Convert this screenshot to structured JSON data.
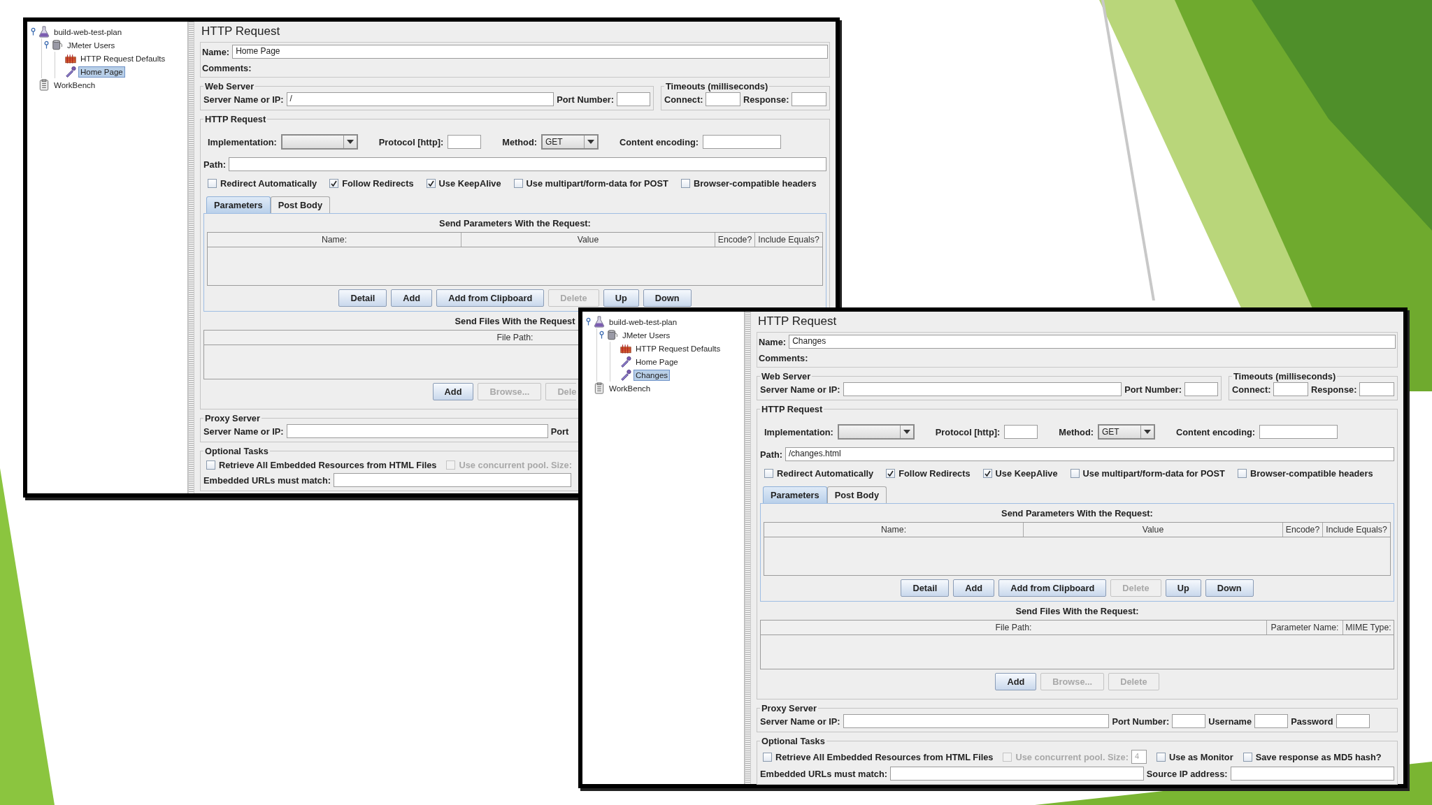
{
  "windows": [
    {
      "tree": [
        {
          "label": "build-web-test-plan",
          "kind": "test-plan",
          "expanded": true,
          "selected": false,
          "children": [
            {
              "label": "JMeter Users",
              "kind": "thread-group",
              "expanded": true,
              "selected": false,
              "children": [
                {
                  "label": "HTTP Request Defaults",
                  "kind": "config",
                  "selected": false
                },
                {
                  "label": "Home Page",
                  "kind": "sampler",
                  "selected": true
                }
              ]
            }
          ]
        },
        {
          "label": "WorkBench",
          "kind": "workbench",
          "selected": false
        }
      ],
      "panel": {
        "title": "HTTP Request",
        "name": {
          "label": "Name:",
          "value": "Home Page"
        },
        "comments": {
          "label": "Comments:"
        },
        "web_server": {
          "legend": "Web Server",
          "fields": [
            {
              "label": "Server Name or IP:",
              "value": "/"
            },
            {
              "label": "Port Number:"
            }
          ]
        },
        "timeouts": {
          "legend": "Timeouts (milliseconds)",
          "fields": [
            {
              "label": "Connect:"
            },
            {
              "label": "Response:"
            }
          ]
        },
        "http_request": {
          "legend": "HTTP Request",
          "implementation": {
            "label": "Implementation:"
          },
          "protocol": {
            "label": "Protocol [http]:"
          },
          "method": {
            "label": "Method:",
            "value": "GET"
          },
          "encoding": {
            "label": "Content encoding:"
          },
          "path": {
            "label": "Path:"
          },
          "options": [
            {
              "label": "Redirect Automatically",
              "checked": false
            },
            {
              "label": "Follow Redirects",
              "checked": true
            },
            {
              "label": "Use KeepAlive",
              "checked": true
            },
            {
              "label": "Use multipart/form-data for POST",
              "checked": false
            },
            {
              "label": "Browser-compatible headers",
              "checked": false
            }
          ],
          "tabs": [
            {
              "label": "Parameters",
              "selected": true
            },
            {
              "label": "Post Body",
              "selected": false
            }
          ],
          "parameters": {
            "caption": "Send Parameters With the Request:",
            "columns": [
              "Name:",
              "Value",
              "Encode?",
              "Include Equals?"
            ],
            "buttons": [
              {
                "label": "Detail",
                "disabled": false
              },
              {
                "label": "Add",
                "disabled": false
              },
              {
                "label": "Add from Clipboard",
                "disabled": false
              },
              {
                "label": "Delete",
                "disabled": true
              },
              {
                "label": "Up",
                "disabled": false
              },
              {
                "label": "Down",
                "disabled": false
              }
            ]
          },
          "files": {
            "caption": "Send Files With the Request",
            "columns": [
              "File Path:"
            ],
            "buttons": [
              {
                "label": "Add",
                "disabled": false
              },
              {
                "label": "Browse...",
                "disabled": true
              },
              {
                "label": "Dele",
                "disabled": true
              }
            ]
          }
        },
        "proxy": {
          "legend": "Proxy Server",
          "fields": [
            {
              "label": "Server Name or IP:"
            },
            {
              "label": "Port"
            }
          ]
        },
        "optional": {
          "legend": "Optional Tasks",
          "checks": [
            {
              "label": "Retrieve All Embedded Resources from HTML Files",
              "checked": false,
              "disabled": false
            },
            {
              "label": "Use concurrent pool. Size:",
              "checked": false,
              "disabled": true
            }
          ],
          "fields": [
            {
              "label": "Embedded URLs must match:"
            }
          ]
        }
      }
    },
    {
      "tree": [
        {
          "label": "build-web-test-plan",
          "kind": "test-plan",
          "expanded": true,
          "selected": false,
          "children": [
            {
              "label": "JMeter Users",
              "kind": "thread-group",
              "expanded": true,
              "selected": false,
              "children": [
                {
                  "label": "HTTP Request Defaults",
                  "kind": "config",
                  "selected": false
                },
                {
                  "label": "Home Page",
                  "kind": "sampler",
                  "selected": false
                },
                {
                  "label": "Changes",
                  "kind": "sampler",
                  "selected": true
                }
              ]
            }
          ]
        },
        {
          "label": "WorkBench",
          "kind": "workbench",
          "selected": false
        }
      ],
      "panel": {
        "title": "HTTP Request",
        "name": {
          "label": "Name:",
          "value": "Changes"
        },
        "comments": {
          "label": "Comments:"
        },
        "web_server": {
          "legend": "Web Server",
          "fields": [
            {
              "label": "Server Name or IP:"
            },
            {
              "label": "Port Number:"
            }
          ]
        },
        "timeouts": {
          "legend": "Timeouts (milliseconds)",
          "fields": [
            {
              "label": "Connect:"
            },
            {
              "label": "Response:"
            }
          ]
        },
        "http_request": {
          "legend": "HTTP Request",
          "implementation": {
            "label": "Implementation:"
          },
          "protocol": {
            "label": "Protocol [http]:"
          },
          "method": {
            "label": "Method:",
            "value": "GET"
          },
          "encoding": {
            "label": "Content encoding:"
          },
          "path": {
            "label": "Path:",
            "value": "/changes.html"
          },
          "options": [
            {
              "label": "Redirect Automatically",
              "checked": false
            },
            {
              "label": "Follow Redirects",
              "checked": true
            },
            {
              "label": "Use KeepAlive",
              "checked": true
            },
            {
              "label": "Use multipart/form-data for POST",
              "checked": false
            },
            {
              "label": "Browser-compatible headers",
              "checked": false
            }
          ],
          "tabs": [
            {
              "label": "Parameters",
              "selected": true
            },
            {
              "label": "Post Body",
              "selected": false
            }
          ],
          "parameters": {
            "caption": "Send Parameters With the Request:",
            "columns": [
              "Name:",
              "Value",
              "Encode?",
              "Include Equals?"
            ],
            "buttons": [
              {
                "label": "Detail",
                "disabled": false
              },
              {
                "label": "Add",
                "disabled": false
              },
              {
                "label": "Add from Clipboard",
                "disabled": false
              },
              {
                "label": "Delete",
                "disabled": true
              },
              {
                "label": "Up",
                "disabled": false
              },
              {
                "label": "Down",
                "disabled": false
              }
            ]
          },
          "files": {
            "caption": "Send Files With the Request:",
            "columns": [
              "File Path:",
              "Parameter Name:",
              "MIME Type:"
            ],
            "buttons": [
              {
                "label": "Add",
                "disabled": false
              },
              {
                "label": "Browse...",
                "disabled": true
              },
              {
                "label": "Delete",
                "disabled": true
              }
            ]
          }
        },
        "proxy": {
          "legend": "Proxy Server",
          "fields": [
            {
              "label": "Server Name or IP:"
            },
            {
              "label": "Port Number:"
            },
            {
              "label": "Username"
            },
            {
              "label": "Password"
            }
          ]
        },
        "optional": {
          "legend": "Optional Tasks",
          "checks": [
            {
              "label": "Retrieve All Embedded Resources from HTML Files",
              "checked": false,
              "disabled": false
            },
            {
              "label": "Use concurrent pool. Size:",
              "checked": false,
              "disabled": true,
              "size": "4"
            },
            {
              "label": "Use as Monitor",
              "checked": false,
              "disabled": false
            },
            {
              "label": "Save response as MD5 hash?",
              "checked": false,
              "disabled": false
            }
          ],
          "fields": [
            {
              "label": "Embedded URLs must match:"
            },
            {
              "label": "Source IP address:"
            }
          ]
        }
      }
    }
  ]
}
